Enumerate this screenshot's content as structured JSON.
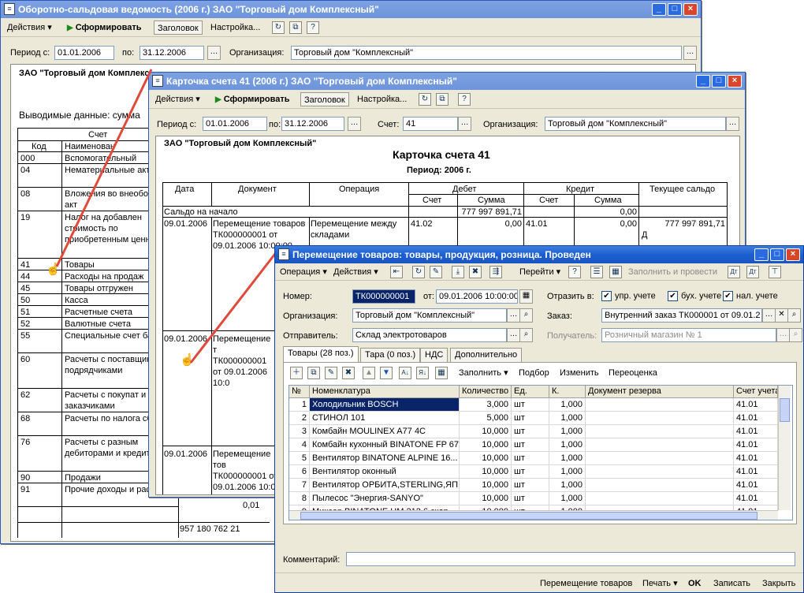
{
  "win1": {
    "title": "Оборотно-сальдовая ведомость (2006 г.) ЗАО \"Торговый дом Комплексный\"",
    "toolbar": {
      "actions": "Действия",
      "form": "Сформировать",
      "header": "Заголовок",
      "settings": "Настройка...",
      "help": "?"
    },
    "period_from_label": "Период с:",
    "period_from": "01.01.2006",
    "period_to_label": "по:",
    "period_to": "31.12.2006",
    "org_label": "Организация:",
    "org": "Торговый дом \"Комплексный\"",
    "report_org": "ЗАО \"Торговый дом Комплекс",
    "output_label": "Выводимые данные: сумма",
    "head_account": "Счет",
    "head_code": "Код",
    "head_name": "Наименован",
    "rows": [
      {
        "code": "000",
        "name": "Вспомогательный"
      },
      {
        "code": "04",
        "name": "Нематериальные активы"
      },
      {
        "code": "08",
        "name": "Вложения во внеоборотные акт"
      },
      {
        "code": "19",
        "name": "Налог на добавлен стоимость по приобретенным ценностям"
      },
      {
        "code": "41",
        "name": "Товары"
      },
      {
        "code": "44",
        "name": "Расходы на продаж"
      },
      {
        "code": "45",
        "name": "Товары отгружен"
      },
      {
        "code": "50",
        "name": "Касса"
      },
      {
        "code": "51",
        "name": "Расчетные счета"
      },
      {
        "code": "52",
        "name": "Валютные счета"
      },
      {
        "code": "55",
        "name": "Специальные счет банках"
      },
      {
        "code": "60",
        "name": "Расчеты с поставщиками и подрядчиками"
      },
      {
        "code": "62",
        "name": "Расчеты с покупат и заказчиками"
      },
      {
        "code": "68",
        "name": "Расчеты по налога сборам"
      },
      {
        "code": "76",
        "name": "Расчеты с разным дебиторами и кредиторами"
      },
      {
        "code": "90",
        "name": "Продажи"
      },
      {
        "code": "91",
        "name": "Прочие доходы и расходы"
      }
    ],
    "amount_91": "0,01",
    "total_partial": "957 180 762 21"
  },
  "win2": {
    "title": "Карточка счета 41 (2006 г.) ЗАО \"Торговый дом Комплексный\"",
    "toolbar": {
      "actions": "Действия",
      "form": "Сформировать",
      "header": "Заголовок",
      "settings": "Настройка...",
      "help": "?"
    },
    "period_from_label": "Период с:",
    "period_from": "01.01.2006",
    "period_to_label": "по:",
    "period_to": "31.12.2006",
    "account_label": "Счет:",
    "account": "41",
    "org_label": "Организация:",
    "org": "Торговый дом \"Комплексный\"",
    "report_org": "ЗАО \"Торговый дом Комплексный\"",
    "report_title": "Карточка счета 41",
    "report_period": "Период: 2006 г.",
    "h_date": "Дата",
    "h_doc": "Документ",
    "h_op": "Операция",
    "h_debit": "Дебет",
    "h_credit": "Кредит",
    "h_saldo": "Текущее сальдо",
    "h_acc": "Счет",
    "h_sum": "Сумма",
    "opening_label": "Сальдо на начало",
    "opening_debit": "777 997 891,71",
    "opening_credit": "0,00",
    "e1_date": "09.01.2006",
    "e1_doc": "Перемещение товаров ТК000000001 от 09.01.2006 10:00:00",
    "e1_op": "Перемещение между складами",
    "e1_dacc": "41.02",
    "e1_dsum": "0,00",
    "e1_cacc": "41.01",
    "e1_csum": "0,00",
    "e1_saldo": "777 997 891,71",
    "e1_saldo2": "Д",
    "e2_date": "09.01.2006",
    "e2_doc": "Перемещение т ТК000000001 от 09.01.2006 10:0",
    "e3_date": "09.01.2006",
    "e3_doc": "Перемещение тов ТК000000001 от 09.01.2006 10:0"
  },
  "win3": {
    "title": "Перемещение товаров: товары, продукция, розница. Проведен",
    "toolbar": {
      "operation": "Операция",
      "actions": "Действия",
      "goto": "Перейти",
      "help": "?",
      "fill_post": "Заполнить и провести"
    },
    "number_label": "Номер:",
    "number": "ТК000000001",
    "date_label": "от:",
    "date": "09.01.2006 10:00:00",
    "reflect_label": "Отразить в:",
    "chk_upr": "упр. учете",
    "chk_buh": "бух. учете",
    "chk_nal": "нал. учете",
    "org_label": "Организация:",
    "org": "Торговый дом \"Комплексный\"",
    "order_label": "Заказ:",
    "order": "Внутренний заказ ТК000001 от 09.01.2",
    "sender_label": "Отправитель:",
    "sender": "Склад электротоваров",
    "receiver_label": "Получатель:",
    "receiver": "Розничный магазин № 1",
    "tabs": [
      "Товары (28 поз.)",
      "Тара (0 поз.)",
      "НДС",
      "Дополнительно"
    ],
    "grid_toolbar": {
      "fill": "Заполнить",
      "pick": "Подбор",
      "change": "Изменить",
      "reval": "Переоценка"
    },
    "columns": [
      "№",
      "Номенклатура",
      "Количество",
      "Ед.",
      "К.",
      "Документ резерва",
      "Счет учета"
    ],
    "rows": [
      {
        "n": "1",
        "name": "Холодильник BOSCH",
        "qty": "3,000",
        "unit": "шт",
        "k": "1,000",
        "acc": "41.01"
      },
      {
        "n": "2",
        "name": "СТИНОЛ 101",
        "qty": "5,000",
        "unit": "шт",
        "k": "1,000",
        "acc": "41.01"
      },
      {
        "n": "3",
        "name": "Комбайн MOULINEX  A77 4C",
        "qty": "10,000",
        "unit": "шт",
        "k": "1,000",
        "acc": "41.01"
      },
      {
        "n": "4",
        "name": "Комбайн кухонный BINATONE FP 67",
        "qty": "10,000",
        "unit": "шт",
        "k": "1,000",
        "acc": "41.01"
      },
      {
        "n": "5",
        "name": "Вентилятор BINATONE ALPINE 16...",
        "qty": "10,000",
        "unit": "шт",
        "k": "1,000",
        "acc": "41.01"
      },
      {
        "n": "6",
        "name": "Вентилятор оконный",
        "qty": "10,000",
        "unit": "шт",
        "k": "1,000",
        "acc": "41.01"
      },
      {
        "n": "7",
        "name": "Вентилятор ОРБИТА,STERLING,ЯП...",
        "qty": "10,000",
        "unit": "шт",
        "k": "1,000",
        "acc": "41.01"
      },
      {
        "n": "8",
        "name": "Пылесос \"Энергия-SANYO\"",
        "qty": "10,000",
        "unit": "шт",
        "k": "1,000",
        "acc": "41.01"
      },
      {
        "n": "9",
        "name": "Миксер BINATONE HM 212 6 скор",
        "qty": "10,000",
        "unit": "шт",
        "k": "1,000",
        "acc": "41.01"
      }
    ],
    "comment_label": "Комментарий:",
    "bottom": {
      "print_form": "Перемещение товаров",
      "print": "Печать",
      "ok": "OK",
      "save": "Записать",
      "close": "Закрыть"
    }
  }
}
